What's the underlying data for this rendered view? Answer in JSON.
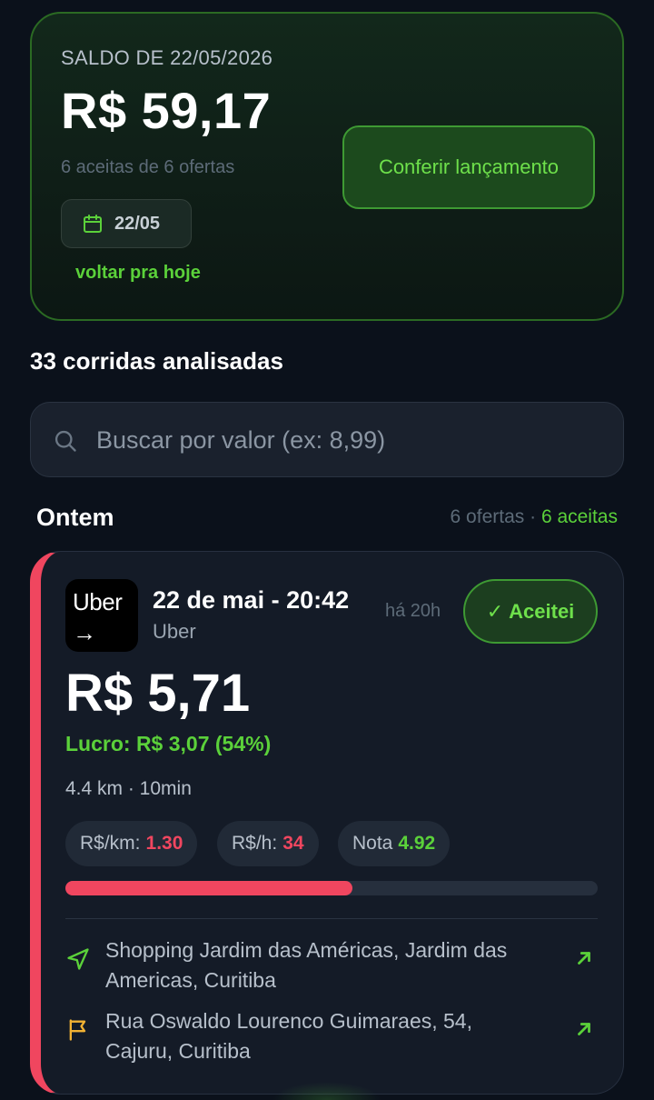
{
  "balance": {
    "date_label": "SALDO DE 22/05/2026",
    "amount": "R$ 59,17",
    "summary": "6 aceitas de 6 ofertas",
    "date_chip": "22/05",
    "back_today": "voltar pra hoje",
    "check_button": "Conferir lançamento"
  },
  "analyzed_count": "33 corridas analisadas",
  "search": {
    "placeholder": "Buscar por valor (ex: 8,99)",
    "value": ""
  },
  "group": {
    "title": "Ontem",
    "offers": "6 ofertas",
    "separator": " · ",
    "accepted": "6 aceitas"
  },
  "ride": {
    "logo_text": "Uber",
    "logo_arrow": "→",
    "datetime": "22 de mai - 20:42",
    "app": "Uber",
    "ago": "há 20h",
    "status_check": "✓",
    "status": "Aceitei",
    "price": "R$ 5,71",
    "profit": "Lucro: R$ 3,07 (54%)",
    "distance_time": "4.4 km · 10min",
    "metrics": [
      {
        "label": "R$/km:",
        "value": "1.30"
      },
      {
        "label": "R$/h:",
        "value": "34"
      },
      {
        "label": "Nota",
        "value": "4.92"
      }
    ],
    "score_fraction": 0.54,
    "pickup": "Shopping Jardim das Américas, Jardim das Americas, Curitiba",
    "dropoff": "Rua Oswaldo Lourenco Guimaraes, 54, Cajuru, Curitiba"
  },
  "colors": {
    "accent_green": "#5bd13a",
    "alert_red": "#f0465f",
    "pin_yellow": "#f2b233",
    "background": "#0b111b"
  },
  "icons": {
    "calendar": "calendar-icon",
    "search": "search-icon",
    "pickup": "navigation-arrow-icon",
    "dropoff": "flag-icon",
    "open": "arrow-up-right-icon"
  }
}
